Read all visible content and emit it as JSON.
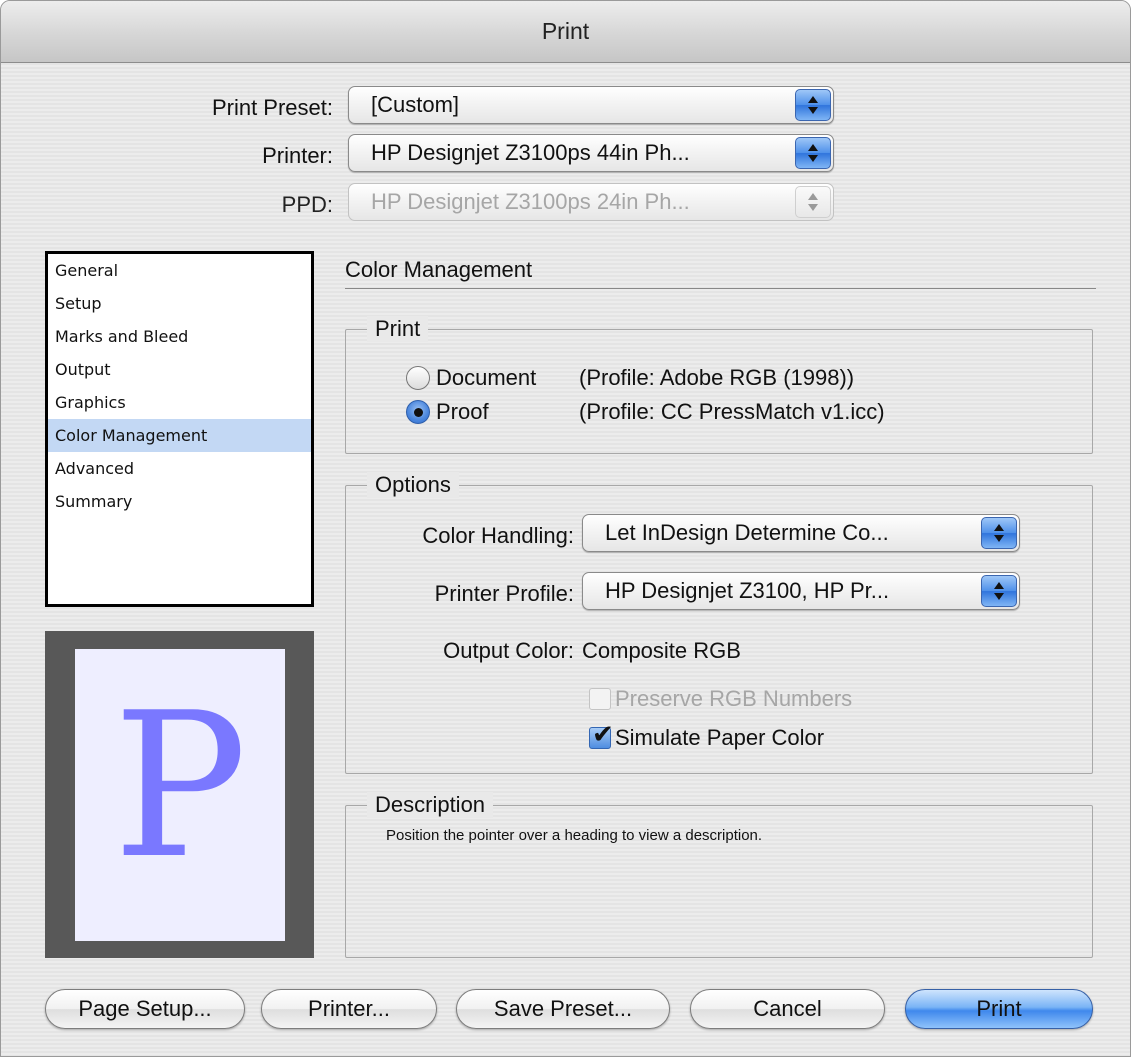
{
  "window": {
    "title": "Print"
  },
  "header": {
    "print_preset": {
      "label": "Print Preset:",
      "value": "[Custom]"
    },
    "printer": {
      "label": "Printer:",
      "value": "HP Designjet Z3100ps 44in Ph..."
    },
    "ppd": {
      "label": "PPD:",
      "value": "HP Designjet Z3100ps 24in Ph..."
    }
  },
  "sidebar": {
    "items": [
      {
        "label": "General"
      },
      {
        "label": "Setup"
      },
      {
        "label": "Marks and Bleed"
      },
      {
        "label": "Output"
      },
      {
        "label": "Graphics"
      },
      {
        "label": "Color Management",
        "selected": true
      },
      {
        "label": "Advanced"
      },
      {
        "label": "Summary"
      }
    ]
  },
  "preview": {
    "glyph": "P",
    "page_color": "#eeeeff",
    "glyph_color": "#7a78ff"
  },
  "panel": {
    "title": "Color Management",
    "print_group": {
      "label": "Print",
      "document": {
        "label": "Document",
        "profile": "(Profile: Adobe RGB (1998))",
        "checked": false
      },
      "proof": {
        "label": "Proof",
        "profile": "(Profile: CC PressMatch v1.icc)",
        "checked": true
      }
    },
    "options_group": {
      "label": "Options",
      "color_handling": {
        "label": "Color Handling:",
        "value": "Let InDesign Determine Co..."
      },
      "printer_profile": {
        "label": "Printer Profile:",
        "value": "HP Designjet Z3100, HP Pr..."
      },
      "output_color": {
        "label": "Output Color:",
        "value": "Composite RGB"
      },
      "preserve_rgb": {
        "label": "Preserve RGB Numbers",
        "checked": false,
        "enabled": false
      },
      "simulate_paper": {
        "label": "Simulate Paper Color",
        "checked": true,
        "enabled": true
      }
    },
    "description_group": {
      "label": "Description",
      "text": "Position the pointer over a heading to view a description."
    }
  },
  "buttons": {
    "page_setup": "Page Setup...",
    "printer": "Printer...",
    "save_preset": "Save Preset...",
    "cancel": "Cancel",
    "print": "Print"
  },
  "colors": {
    "accent": "#4e90ea",
    "selection": "#c3d8f4"
  }
}
